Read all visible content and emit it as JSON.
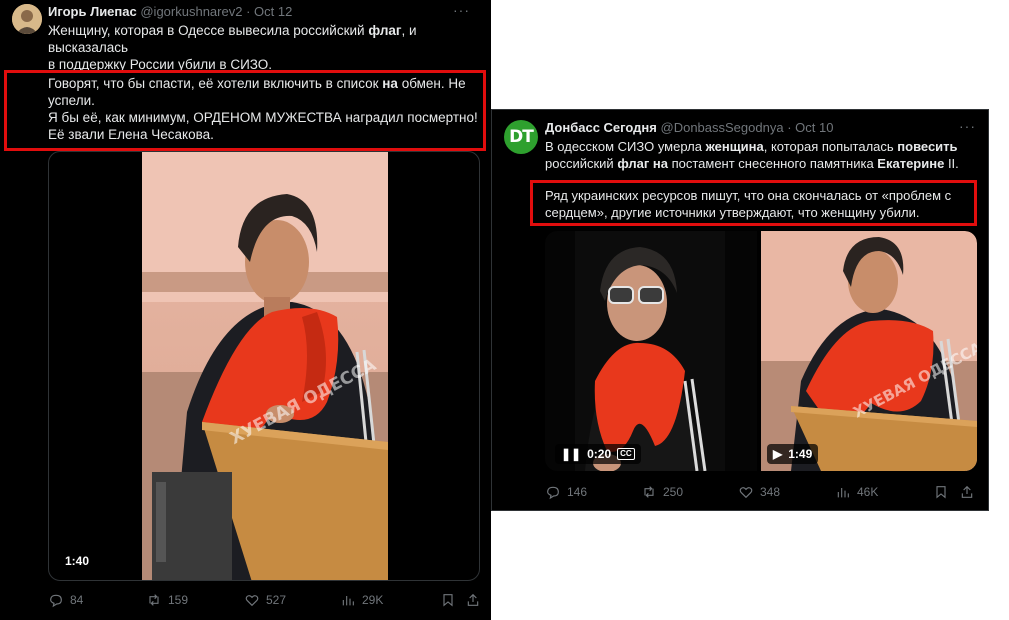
{
  "left_tweet": {
    "author_name": "Игорь Лиепас",
    "author_handle": "@igorkushnarev2",
    "date": "Oct 12",
    "line1": "Женщину, которая в Одессе вывесила российский ",
    "line1_bold": "флаг",
    "line1_end": ", и высказалась",
    "line2": "в поддержку России убили в СИЗО.",
    "boxed_line1_a": "Говорят, что бы спасти, её хотели включить в список ",
    "boxed_line1_bold": "на",
    "boxed_line1_b": " обмен. Не",
    "boxed_line2": "успели.",
    "boxed_line3": "Я бы её, как минимум, ОРДЕНОМ МУЖЕСТВА наградил посмертно!",
    "boxed_line4": "Её звали Елена Чесакова.",
    "video_duration": "1:40",
    "watermark": "ХУЕВАЯ ОДЕССА",
    "replies": "84",
    "reposts": "159",
    "likes": "527",
    "views": "29K"
  },
  "right_tweet": {
    "avatar_text": "DT",
    "author_name": "Донбасс Сегодня",
    "author_handle": "@DonbassSegodnya",
    "date": "Oct 10",
    "l1_a": "В одесском СИЗО умерла ",
    "l1_b": "женщина",
    "l1_c": ", которая попыталась ",
    "l1_d": "повесить",
    "l2_a": "российский ",
    "l2_b": "флаг на",
    "l2_c": " постамент снесенного памятника ",
    "l2_d": "Екатерине",
    "l2_e": " II.",
    "boxed_line1": "Ряд украинских ресурсов пишут, что она скончалась от «проблем с",
    "boxed_line2": "сердцем», другие источники утверждают, что женщину убили.",
    "video1_time": "0:20",
    "video2_time": "1:49",
    "watermark": "ХУЕВАЯ ОДЕССА",
    "replies": "146",
    "reposts": "250",
    "likes": "348",
    "views": "46K"
  },
  "colors": {
    "background": "#000000",
    "text": "#e7e9ea",
    "muted": "#71767b",
    "highlight_box": "#e10d0d",
    "scarf": "#e8381c",
    "dt_green": "#2ea02e"
  }
}
